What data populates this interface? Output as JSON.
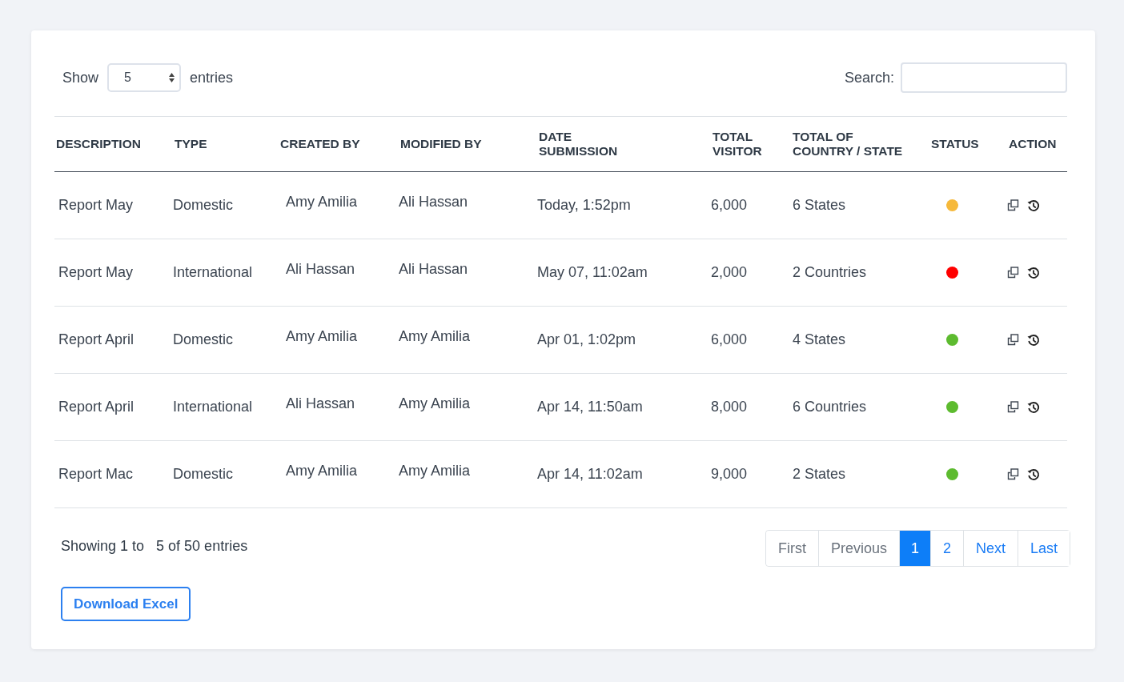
{
  "length_control": {
    "label_before": "Show",
    "value": "5",
    "label_after": "entries"
  },
  "search": {
    "label": "Search:"
  },
  "table": {
    "columns": [
      "DESCRIPTION",
      "TYPE",
      "CREATED BY",
      "MODIFIED BY",
      "DATE SUBMISSION",
      "TOTAL VISITOR",
      "TOTAL OF COUNTRY / STATE",
      "STATUS",
      "ACTION"
    ],
    "rows": [
      {
        "description": "Report May",
        "type": "Domestic",
        "created_by": "Amy Amilia",
        "modified_by": "Ali Hassan",
        "date": "Today, 1:52pm",
        "visitors": "6,000",
        "coverage": "6 States",
        "color": "#f6b93b"
      },
      {
        "description": "Report May",
        "type": "International",
        "created_by": "Ali Hassan",
        "modified_by": "Ali Hassan",
        "date": "May 07, 11:02am",
        "visitors": "2,000",
        "coverage": "2 Countries",
        "color": "#ff0000"
      },
      {
        "description": "Report April",
        "type": "Domestic",
        "created_by": "Amy Amilia",
        "modified_by": "Amy Amilia",
        "date": "Apr 01, 1:02pm",
        "visitors": "6,000",
        "coverage": "4 States",
        "color": "#5dbb2f"
      },
      {
        "description": "Report April",
        "type": "International",
        "created_by": "Ali Hassan",
        "modified_by": "Amy Amilia",
        "date": "Apr 14, 11:50am",
        "visitors": "8,000",
        "coverage": "6 Countries",
        "color": "#5dbb2f"
      },
      {
        "description": "Report Mac",
        "type": "Domestic",
        "created_by": "Amy Amilia",
        "modified_by": "Amy Amilia",
        "date": "Apr 14, 11:02am",
        "visitors": "9,000",
        "coverage": "2 States",
        "color": "#5dbb2f"
      }
    ]
  },
  "info": "Showing 1 to   5 of 50 entries",
  "pagination": [
    {
      "label": "First",
      "selected": false,
      "disabled": true
    },
    {
      "label": "Previous",
      "selected": false,
      "disabled": true
    },
    {
      "label": "1",
      "selected": true,
      "disabled": false
    },
    {
      "label": "2",
      "selected": false,
      "disabled": false
    },
    {
      "label": "Next",
      "selected": false,
      "disabled": false
    },
    {
      "label": "Last",
      "selected": false,
      "disabled": false
    }
  ],
  "download_button": "Download Excel"
}
